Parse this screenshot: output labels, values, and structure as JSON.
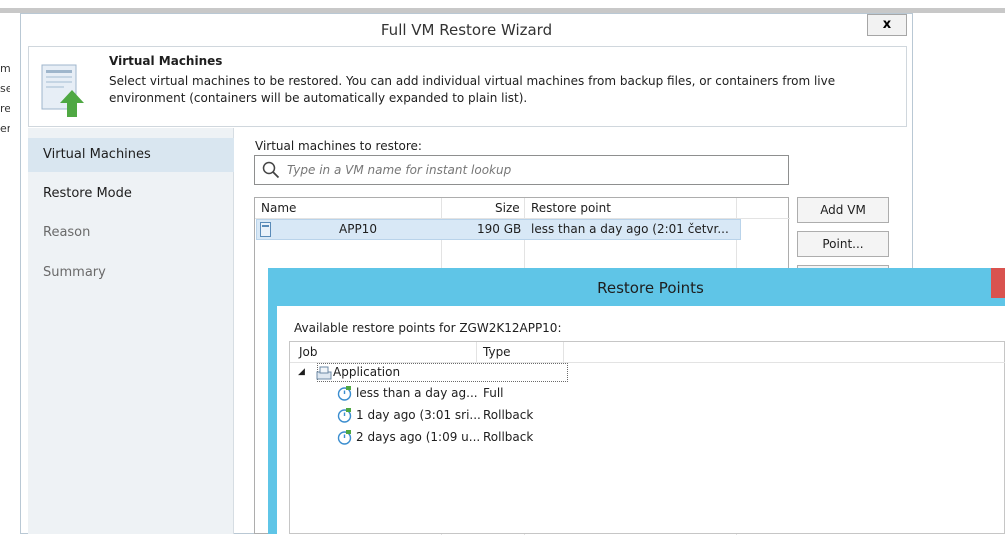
{
  "background_window": {
    "fragments": [
      "m",
      "se",
      "re",
      "er"
    ]
  },
  "wizard": {
    "title": "Full VM Restore Wizard",
    "close_label": "x",
    "header": {
      "title": "Virtual Machines",
      "description": "Select virtual machines to be restored. You  can add individual virtual machines from backup files, or containers from live environment (containers will be automatically expanded to plain list)."
    },
    "steps": [
      {
        "label": "Virtual Machines"
      },
      {
        "label": "Restore Mode"
      },
      {
        "label": "Reason"
      },
      {
        "label": "Summary"
      }
    ],
    "content": {
      "list_label": "Virtual machines to restore:",
      "search_placeholder": "Type in a VM name for instant lookup",
      "columns": {
        "name": "Name",
        "size": "Size",
        "restore_point": "Restore point"
      },
      "rows": [
        {
          "name": "APP10",
          "size": "190 GB",
          "restore_point": "less than a day ago (2:01 četvr..."
        }
      ],
      "buttons": {
        "add_vm": "Add VM",
        "point": "Point..."
      }
    }
  },
  "restore_points": {
    "title": "Restore Points",
    "label": "Available restore points for ZGW2K12APP10:",
    "columns": {
      "job": "Job",
      "type": "Type"
    },
    "group": "Application",
    "items": [
      {
        "job": "less than a day ag...",
        "type": "Full"
      },
      {
        "job": "1 day ago (3:01 sri...",
        "type": "Rollback"
      },
      {
        "job": "2 days ago (1:09 u...",
        "type": "Rollback"
      }
    ]
  },
  "colors": {
    "dialog_titlebar": "#5fc5e7",
    "selected_row": "#d8e8f6",
    "steps_panel": "#eef2f5",
    "restore_icon_green": "#4fa843"
  }
}
